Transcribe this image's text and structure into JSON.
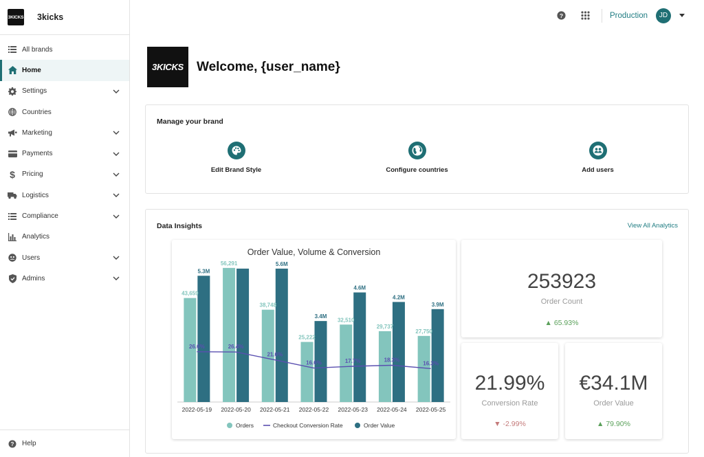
{
  "brand": {
    "logo_text": "3KICKS",
    "name": "3kicks"
  },
  "sidebar": {
    "items": [
      {
        "label": "All brands",
        "icon": "list-icon",
        "expandable": false,
        "active": false
      },
      {
        "label": "Home",
        "icon": "home-icon",
        "expandable": false,
        "active": true
      },
      {
        "label": "Settings",
        "icon": "gear-icon",
        "expandable": true,
        "active": false
      },
      {
        "label": "Countries",
        "icon": "globe-icon",
        "expandable": false,
        "active": false
      },
      {
        "label": "Marketing",
        "icon": "megaphone-icon",
        "expandable": true,
        "active": false
      },
      {
        "label": "Payments",
        "icon": "card-icon",
        "expandable": true,
        "active": false
      },
      {
        "label": "Pricing",
        "icon": "dollar-icon",
        "expandable": true,
        "active": false
      },
      {
        "label": "Logistics",
        "icon": "truck-icon",
        "expandable": true,
        "active": false
      },
      {
        "label": "Compliance",
        "icon": "list-icon",
        "expandable": true,
        "active": false
      },
      {
        "label": "Analytics",
        "icon": "bar-chart-icon",
        "expandable": false,
        "active": false
      },
      {
        "label": "Users",
        "icon": "user-icon",
        "expandable": true,
        "active": false
      },
      {
        "label": "Admins",
        "icon": "shield-icon",
        "expandable": true,
        "active": false
      }
    ],
    "help_label": "Help"
  },
  "topbar": {
    "environment": "Production",
    "avatar_initials": "JD"
  },
  "welcome": {
    "logo_text": "3KICKS",
    "title": "Welcome, {user_name}"
  },
  "manage": {
    "title": "Manage your brand",
    "actions": [
      {
        "label": "Edit Brand Style",
        "icon": "palette-icon"
      },
      {
        "label": "Configure countries",
        "icon": "globe-icon"
      },
      {
        "label": "Add users",
        "icon": "users-icon"
      }
    ]
  },
  "insights": {
    "title": "Data Insights",
    "view_all": "View All Analytics",
    "kpis": [
      {
        "value": "253923",
        "label": "Order Count",
        "delta": "▲ 65.93%",
        "direction": "up"
      },
      {
        "value": "21.99%",
        "label": "Conversion Rate",
        "delta": "▼ -2.99%",
        "direction": "down"
      },
      {
        "value": "€34.1M",
        "label": "Order Value",
        "delta": "▲ 79.90%",
        "direction": "up"
      }
    ]
  },
  "chart_data": {
    "type": "bar",
    "title": "Order Value, Volume & Conversion",
    "categories": [
      "2022-05-19",
      "2022-05-20",
      "2022-05-21",
      "2022-05-22",
      "2022-05-23",
      "2022-05-24",
      "2022-05-25"
    ],
    "series": [
      {
        "name": "Orders",
        "type": "bar",
        "color": "#83c5bd",
        "values": [
          43659,
          56291,
          38748,
          25222,
          32510,
          29737,
          27750
        ],
        "labels": [
          "43,659",
          "56,291",
          "38,748",
          "25,222",
          "32,510",
          "29,737",
          "27,750"
        ]
      },
      {
        "name": "Order Value",
        "type": "bar",
        "color": "#2e6f82",
        "values": [
          5.3,
          5.6,
          5.6,
          3.4,
          4.6,
          4.2,
          3.9
        ],
        "labels": [
          "5.3M",
          "",
          "5.6M",
          "3.4M",
          "4.6M",
          "4.2M",
          "3.9M"
        ]
      },
      {
        "name": "Checkout Conversion Rate",
        "type": "line",
        "color": "#5a4fb0",
        "values": [
          26.6,
          26.4,
          21.6,
          16.6,
          17.7,
          18.3,
          16.3
        ],
        "labels": [
          "26.6%",
          "26.4%",
          "21.6%",
          "16.6%",
          "17.7%",
          "18.3%",
          "16.3%"
        ]
      }
    ],
    "legend": [
      "Orders",
      "Checkout Conversion Rate",
      "Order Value"
    ],
    "legend_position": "bottom",
    "grid": false
  }
}
